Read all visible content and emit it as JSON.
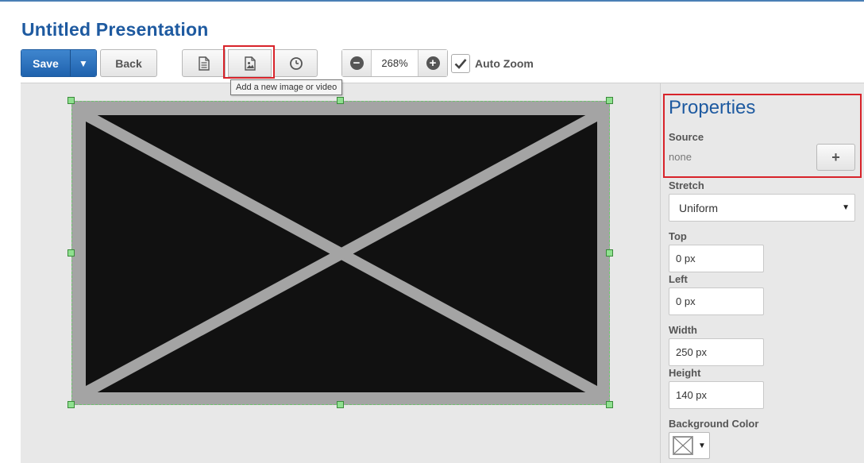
{
  "header": {
    "title": "Untitled Presentation"
  },
  "toolbar": {
    "save_label": "Save",
    "back_label": "Back",
    "zoom_value": "268%",
    "auto_zoom_label": "Auto Zoom",
    "auto_zoom_checked": true,
    "tooltip": "Add a new image or video",
    "icons": [
      "document-icon",
      "image-icon",
      "clock-icon",
      "zoom-out-icon",
      "zoom-in-icon"
    ]
  },
  "properties": {
    "title": "Properties",
    "source_label": "Source",
    "source_value": "none",
    "add_source_label": "+",
    "stretch_label": "Stretch",
    "stretch_value": "Uniform",
    "top_label": "Top",
    "top_value": "0 px",
    "left_label": "Left",
    "left_value": "0 px",
    "width_label": "Width",
    "width_value": "250 px",
    "height_label": "Height",
    "height_value": "140 px",
    "bg_color_label": "Background Color"
  },
  "colors": {
    "accent": "#1e5aa0",
    "save_button": "#2a70bd",
    "highlight": "#d8232a",
    "selection_handle": "#8fe08f",
    "canvas_bg": "#e8e8e8",
    "element_fill": "#111111"
  }
}
